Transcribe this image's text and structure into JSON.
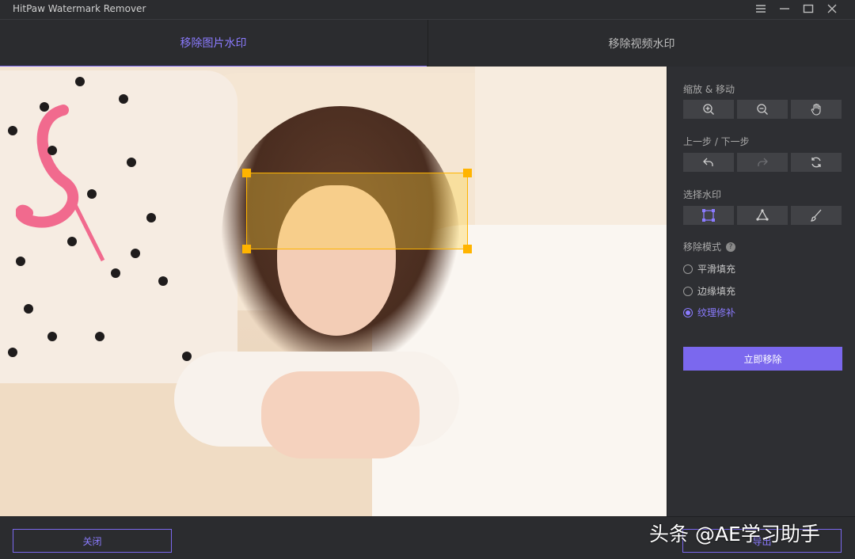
{
  "window": {
    "title": "HitPaw Watermark Remover",
    "controls": [
      "menu-icon",
      "minimize-icon",
      "maximize-icon",
      "close-icon"
    ]
  },
  "tabs": [
    {
      "label": "移除图片水印",
      "active": true
    },
    {
      "label": "移除视频水印",
      "active": false
    }
  ],
  "panel": {
    "zoom_move_label": "缩放 & 移动",
    "zoom_tools": [
      "zoom-in-icon",
      "zoom-out-icon",
      "hand-icon"
    ],
    "undo_redo_label": "上一步 / 下一步",
    "history_tools": [
      "undo-icon",
      "redo-icon",
      "reset-icon"
    ],
    "select_label": "选择水印",
    "select_tools": [
      "rectangle-select-icon",
      "polygon-select-icon",
      "brush-icon"
    ],
    "mode_label": "移除模式",
    "help_glyph": "?",
    "modes": [
      {
        "label": "平滑填充",
        "selected": false
      },
      {
        "label": "边缘填充",
        "selected": false
      },
      {
        "label": "纹理修补",
        "selected": true
      }
    ],
    "remove_button": "立即移除"
  },
  "footer": {
    "close_button": "关闭",
    "export_button": "导出"
  },
  "overlay_watermark": "头条 @AE学习助手",
  "colors": {
    "accent": "#7b68ee",
    "selection": "#ffb400",
    "background": "#2b2c2f"
  }
}
